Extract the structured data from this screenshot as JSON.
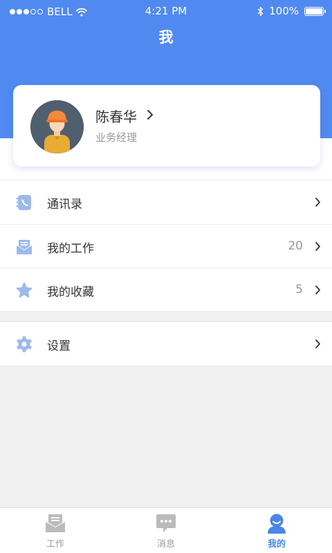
{
  "status_bar": {
    "carrier": "BELL",
    "time": "4:21 PM",
    "battery": "100%",
    "battery_level": 1.0,
    "signal_bars": 3,
    "signal_total": 5
  },
  "header": {
    "title": "我"
  },
  "profile": {
    "name": "陈春华",
    "role": "业务经理",
    "avatar_icon": "worker-avatar-icon"
  },
  "menu": {
    "contacts": {
      "label": "通讯录",
      "icon": "address-book-icon"
    },
    "my_work": {
      "label": "我的工作",
      "count": "20",
      "icon": "mail-tray-icon"
    },
    "favorites": {
      "label": "我的收藏",
      "count": "5",
      "icon": "star-icon"
    },
    "settings": {
      "label": "设置",
      "icon": "gear-icon"
    }
  },
  "tabs": [
    {
      "label": "工作",
      "icon": "mail-tray-icon",
      "active": false
    },
    {
      "label": "消息",
      "icon": "chat-bubble-icon",
      "active": false
    },
    {
      "label": "我的",
      "icon": "person-icon",
      "active": true
    }
  ],
  "colors": {
    "header_blue": "#5089f0",
    "icon_blue": "#9db9ec",
    "active_tab": "#4a86e8",
    "inactive_tab": "#bbbbbb"
  }
}
